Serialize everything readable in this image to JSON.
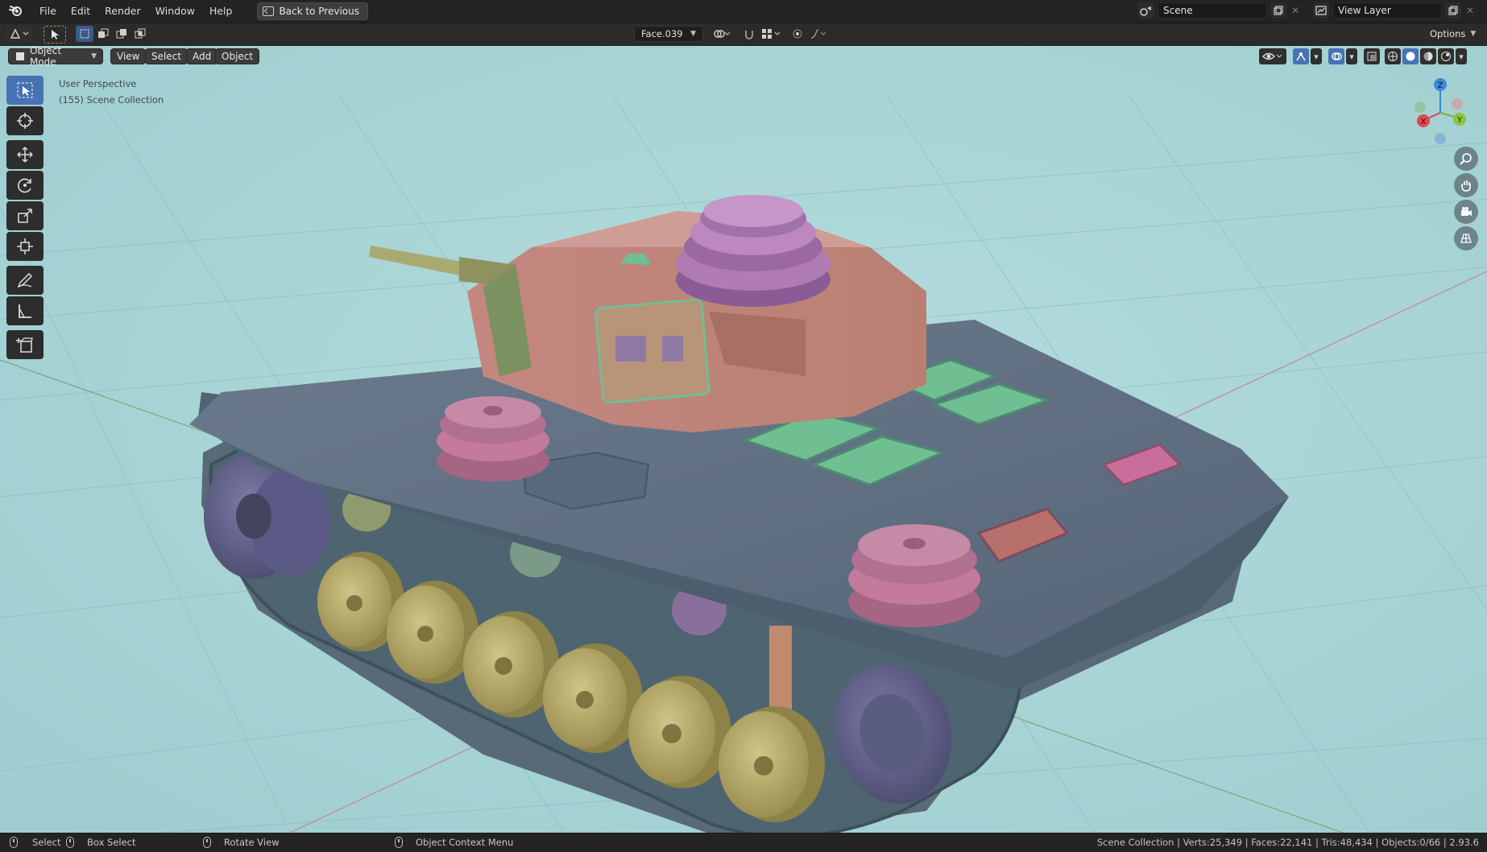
{
  "app": {
    "logo_icon": "blender-logo-icon"
  },
  "menu": {
    "items": [
      "File",
      "Edit",
      "Render",
      "Window",
      "Help"
    ],
    "back_button": "Back to Previous"
  },
  "scene": {
    "label": "Scene",
    "view_layer": "View Layer"
  },
  "tool_header": {
    "face_selector": "Face.039",
    "options": "Options"
  },
  "viewport_header": {
    "mode": "Object Mode",
    "menus": [
      "View",
      "Select",
      "Add",
      "Object"
    ]
  },
  "viewport_info": {
    "perspective": "User Perspective",
    "collection": "(155) Scene Collection"
  },
  "gizmo": {
    "x": "X",
    "y": "Y",
    "z": "Z"
  },
  "colors": {
    "viewport_bg": "#a6d2d4",
    "hull": "#5d6c7e",
    "turret": "#c98e86",
    "cupola": "#b07ab3",
    "road_wheels": "#b9ac6a",
    "hatch_green": "#6fbf93",
    "accent_blue": "#4772b3"
  },
  "status": {
    "select": "Select",
    "box_select": "Box Select",
    "rotate_view": "Rotate View",
    "context_menu": "Object Context Menu",
    "stats": "Scene Collection | Verts:25,349 | Faces:22,141 | Tris:48,434 | Objects:0/66 | 2.93.6"
  }
}
